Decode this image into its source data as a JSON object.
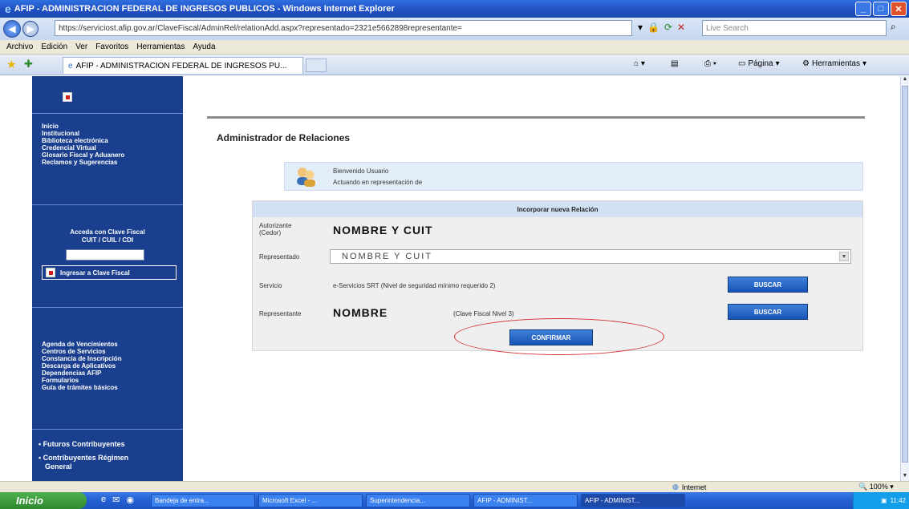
{
  "window": {
    "title": "AFIP - ADMINISTRACION FEDERAL DE INGRESOS PUBLICOS - Windows Internet Explorer"
  },
  "address": {
    "url": "https://serviciost.afip.gov.ar/ClaveFiscal/AdminRel/relationAdd.aspx?representado=2321e5662898representante=",
    "search_placeholder": "Live Search"
  },
  "menu": [
    "Archivo",
    "Edición",
    "Ver",
    "Favoritos",
    "Herramientas",
    "Ayuda"
  ],
  "tab": {
    "label": "AFIP - ADMINISTRACION FEDERAL DE INGRESOS PU..."
  },
  "commands": {
    "page": "Página",
    "tools": "Herramientas"
  },
  "sidebar": {
    "top_links": [
      "Inicio",
      "Institucional",
      "Biblioteca electrónica",
      "Credencial Virtual",
      "Glosario Fiscal y Aduanero",
      "Reclamos y Sugerencias"
    ],
    "login_title_1": "Acceda con Clave Fiscal",
    "login_title_2": "CUIT / CUIL / CDI",
    "login_button": "Ingresar a Clave Fiscal",
    "mid_links": [
      "Agenda de Vencimientos",
      "Centros de Servicios",
      "Constancia de Inscripción",
      "Descarga de Aplicativos",
      "Dependencias AFIP",
      "Formularios",
      "Guía de trámites básicos"
    ],
    "bottom_links": [
      "• Futuros Contribuyentes",
      "• Contribuyentes Régimen",
      "General"
    ]
  },
  "main": {
    "title": "Administrador de Relaciones",
    "welcome_line1": "Bienvenido Usuario",
    "welcome_line2": "Actuando en representación de"
  },
  "form": {
    "header": "Incorporar nueva Relación",
    "autorizante_label": "Autorizante (Cedor)",
    "autorizante_value": "NOMBRE Y CUIT",
    "representado_label": "Representado",
    "representado_value": "NOMBRE Y CUIT",
    "servicio_label": "Servicio",
    "servicio_value": "e-Servicios SRT (Nivel de seguridad mínimo requerido 2)",
    "buscar_1": "BUSCAR",
    "representante_label": "Representante",
    "representante_value": "NOMBRE",
    "clave_nivel": "(Clave Fiscal Nivel 3)",
    "buscar_2": "BUSCAR",
    "confirm": "CONFIRMAR"
  },
  "status": {
    "zone": "Internet",
    "zoom": "100%"
  },
  "taskbar": {
    "start": "Inicio",
    "tasks": [
      "Bandeja de entra...",
      "Microsoft Excel - ...",
      "Superintendencia...",
      "AFIP - ADMINIST...",
      "AFIP - ADMINIST..."
    ],
    "clock": "11:42"
  },
  "colors": {
    "sidebar": "#1a3f8f",
    "button": "#1854b6",
    "highlight_oval": "#d63030"
  }
}
